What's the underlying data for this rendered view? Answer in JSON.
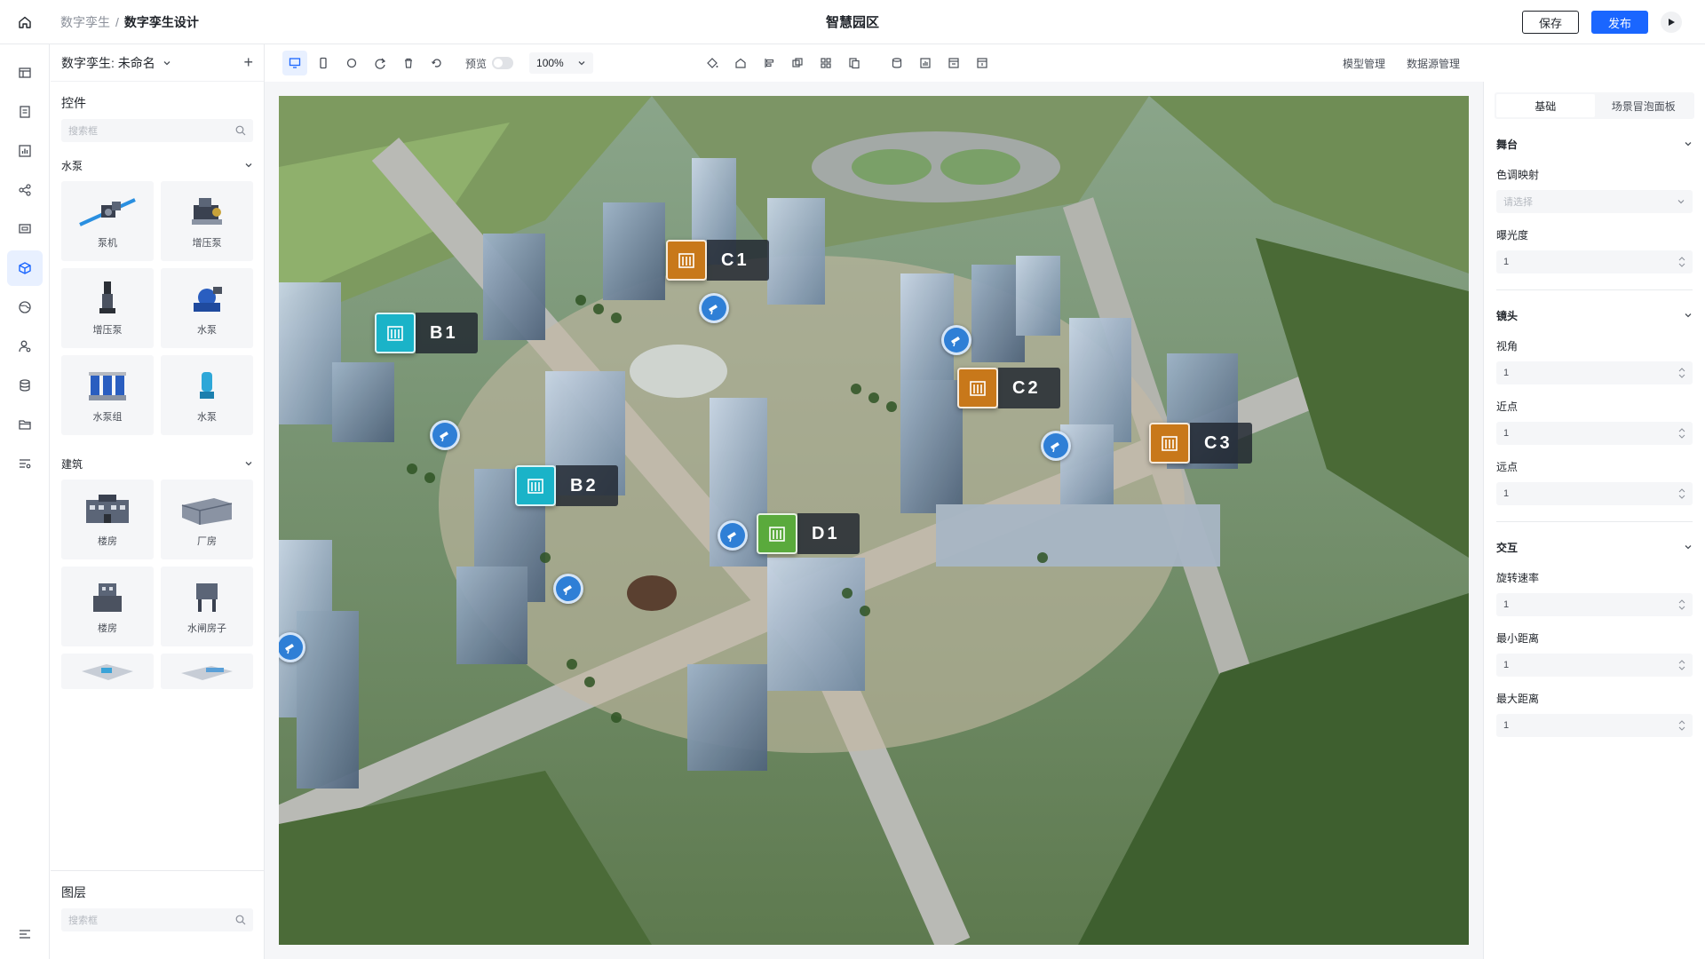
{
  "header": {
    "breadcrumb_root": "数字孪生",
    "breadcrumb_sep": "/",
    "breadcrumb_current": "数字孪生设计",
    "title": "智慧园区",
    "save_label": "保存",
    "publish_label": "发布"
  },
  "rail": {
    "items": [
      "layout-icon",
      "document-icon",
      "chart-icon",
      "share-icon",
      "screen-icon",
      "cube-icon",
      "globe-icon",
      "user-settings-icon",
      "database-icon",
      "folder-icon",
      "list-settings-icon"
    ],
    "active_index": 5
  },
  "left": {
    "project_name": "数字孪生: 未命名",
    "add_symbol": "+",
    "widgets_title": "控件",
    "search_placeholder": "搜索框",
    "categories": [
      {
        "name": "水泵",
        "items": [
          "泵机",
          "增压泵",
          "增压泵",
          "水泵",
          "水泵组",
          "水泵"
        ]
      },
      {
        "name": "建筑",
        "items": [
          "楼房",
          "厂房",
          "楼房",
          "水闸房子"
        ]
      }
    ],
    "layers_title": "图层",
    "layers_search_placeholder": "搜索框"
  },
  "toolbar": {
    "preview_label": "预览",
    "zoom_value": "100%",
    "model_manage": "模型管理",
    "datasource_manage": "数据源管理"
  },
  "scene": {
    "markers": [
      {
        "label": "C1",
        "color": "#c8781a"
      },
      {
        "label": "B1",
        "color": "#1ab3c8"
      },
      {
        "label": "C2",
        "color": "#c8781a"
      },
      {
        "label": "C3",
        "color": "#c8781a"
      },
      {
        "label": "B2",
        "color": "#1ab3c8"
      },
      {
        "label": "D1",
        "color": "#5aaa3c"
      }
    ],
    "camera_icon": "camera-icon"
  },
  "right": {
    "tabs": [
      "基础",
      "场景冒泡面板"
    ],
    "active_tab": 0,
    "groups": [
      {
        "title": "舞台",
        "fields": [
          {
            "label": "色调映射",
            "value": "",
            "placeholder": "请选择",
            "kind": "select"
          },
          {
            "label": "曝光度",
            "value": "1",
            "kind": "number"
          }
        ]
      },
      {
        "title": "镜头",
        "fields": [
          {
            "label": "视角",
            "value": "1",
            "kind": "number"
          },
          {
            "label": "近点",
            "value": "1",
            "kind": "number"
          },
          {
            "label": "远点",
            "value": "1",
            "kind": "number"
          }
        ]
      },
      {
        "title": "交互",
        "fields": [
          {
            "label": "旋转速率",
            "value": "1",
            "kind": "number"
          },
          {
            "label": "最小距离",
            "value": "1",
            "kind": "number"
          },
          {
            "label": "最大距离",
            "value": "1",
            "kind": "number"
          }
        ]
      }
    ]
  },
  "colors": {
    "accent": "#1a66ff",
    "active_bg": "#e8f0ff"
  }
}
